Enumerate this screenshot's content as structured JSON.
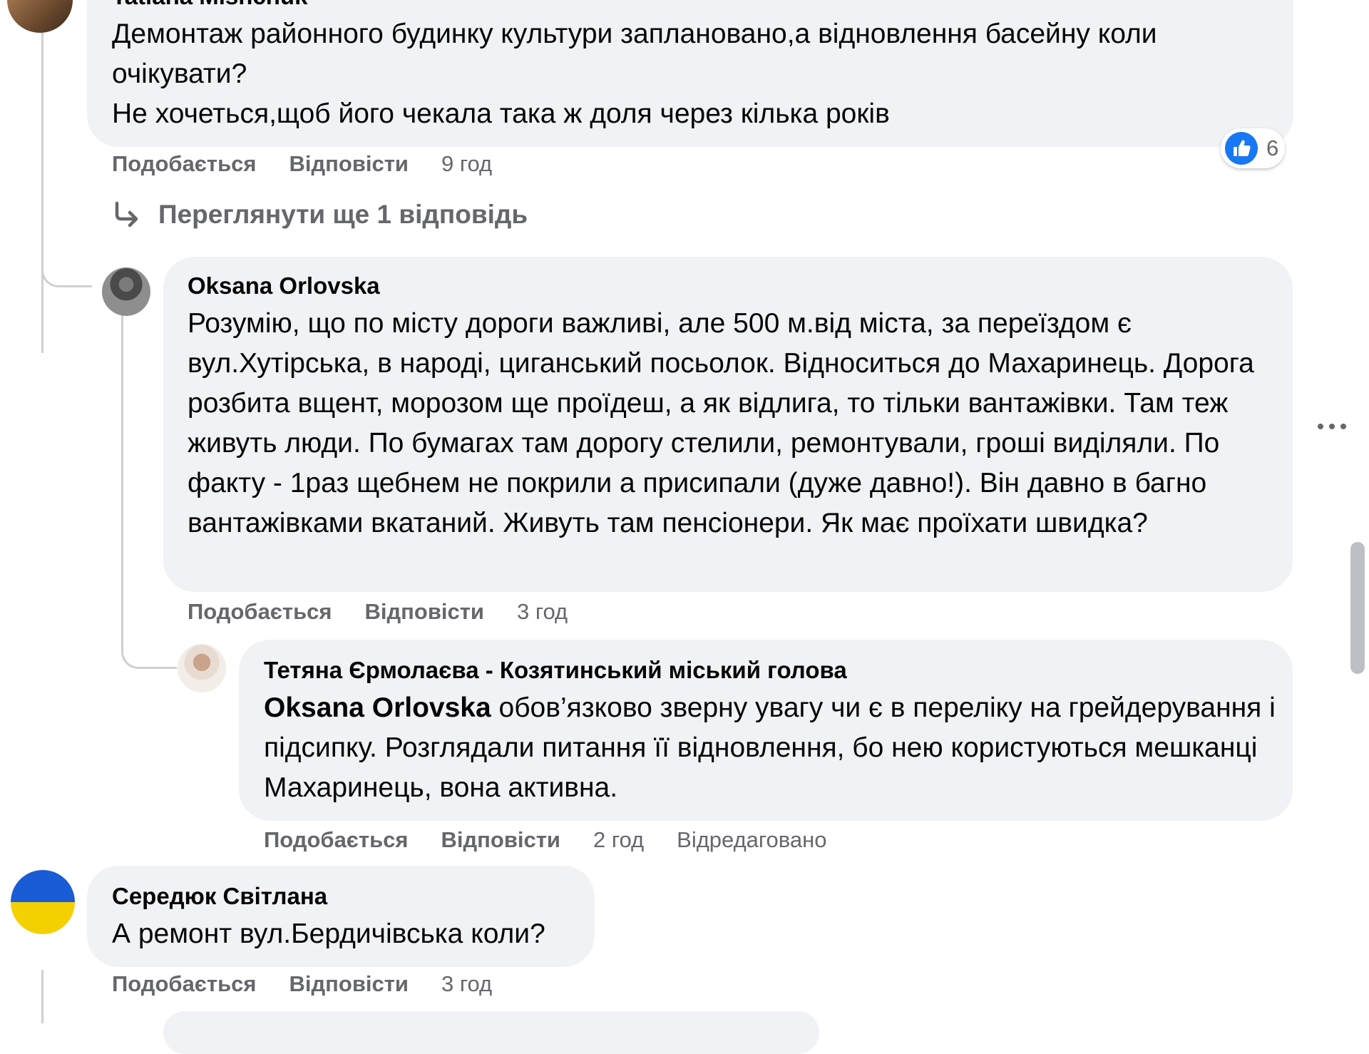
{
  "comments": [
    {
      "author": "Tatiana Mishchuk",
      "paragraphs": [
        "Демонтаж районного будинку культури заплановано,а відновлення басейну коли очікувати?",
        "Не хочеться,щоб його чекала така ж доля через кілька років"
      ],
      "like_label": "Подобається",
      "reply_label": "Відповісти",
      "time": "9 год",
      "reaction_count": "6",
      "view_more": "Переглянути ще 1 відповідь"
    },
    {
      "author": "Oksana Orlovska",
      "text": "Розумію, що по місту дороги важливі, але 500 м.від міста, за переїздом є вул.Хутірська, в народі, циганський посьолок. Відноситься до Махаринець. Дорога розбита вщент, морозом ще проїдеш, а як відлига, то тільки вантажівки. Там теж живуть люди. По бумагах там дорогу стелили, ремонтували, гроші виділяли. По факту - 1раз щебнем не покрили а присипали (дуже давно!). Він давно в багно вантажівками вкатаний. Живуть там пенсіонери. Як має проїхати швидка?",
      "like_label": "Подобається",
      "reply_label": "Відповісти",
      "time": "3 год"
    },
    {
      "author": "Тетяна Єрмолаєва - Козятинський міський голова",
      "mention": "Oksana Orlovska",
      "text": " обов’язково зверну увагу чи є в переліку на грейдерування і підсипку. Розглядали питання її відновлення, бо нею користуються мешканці Махаринець, вона активна.",
      "like_label": "Подобається",
      "reply_label": "Відповісти",
      "time": "2 год",
      "edited": "Відредаговано"
    },
    {
      "author": "Середюк Світлана",
      "text": "А ремонт вул.Бердичівська коли?",
      "like_label": "Подобається",
      "reply_label": "Відповісти",
      "time": "3 год"
    }
  ],
  "icons": {
    "reaction": "like-icon",
    "reply_arrow": "reply-arrow-icon",
    "more": "more-icon"
  },
  "colors": {
    "bubble": "#f0f2f5",
    "meta": "#65676b",
    "like_blue": "#1877f2",
    "thread_line": "#ced0d4",
    "flag_blue": "#1a5bd6",
    "flag_yellow": "#f4d000"
  }
}
